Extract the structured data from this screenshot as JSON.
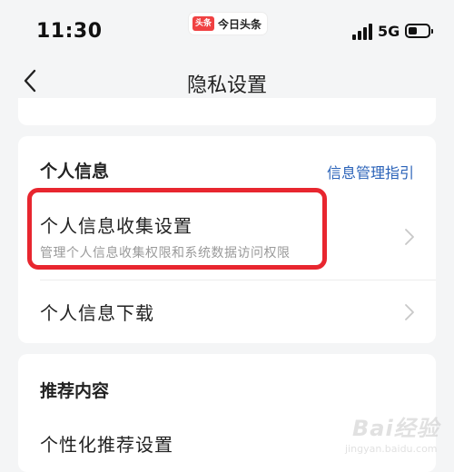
{
  "status_bar": {
    "time": "11:30",
    "app_logo": "头条",
    "app_name": "今日头条",
    "network": "5G",
    "battery_level": 0.45
  },
  "nav": {
    "title": "隐私设置",
    "back_icon": "chevron-left-icon"
  },
  "personal_info": {
    "section_title": "个人信息",
    "guide_link": "信息管理指引",
    "rows": [
      {
        "title": "个人信息收集设置",
        "subtitle": "管理个人信息收集权限和系统数据访问权限"
      },
      {
        "title": "个人信息下载"
      }
    ]
  },
  "recommend": {
    "section_title": "推荐内容",
    "rows": [
      {
        "title": "个性化推荐设置"
      }
    ]
  },
  "watermark": {
    "text": "Bai经验",
    "url": "jingyan.baidu.com"
  },
  "colors": {
    "background": "#f4f5f6",
    "card": "#ffffff",
    "link": "#2a62b8",
    "highlight": "#e8262f",
    "subtitle": "#9a9a9a"
  }
}
